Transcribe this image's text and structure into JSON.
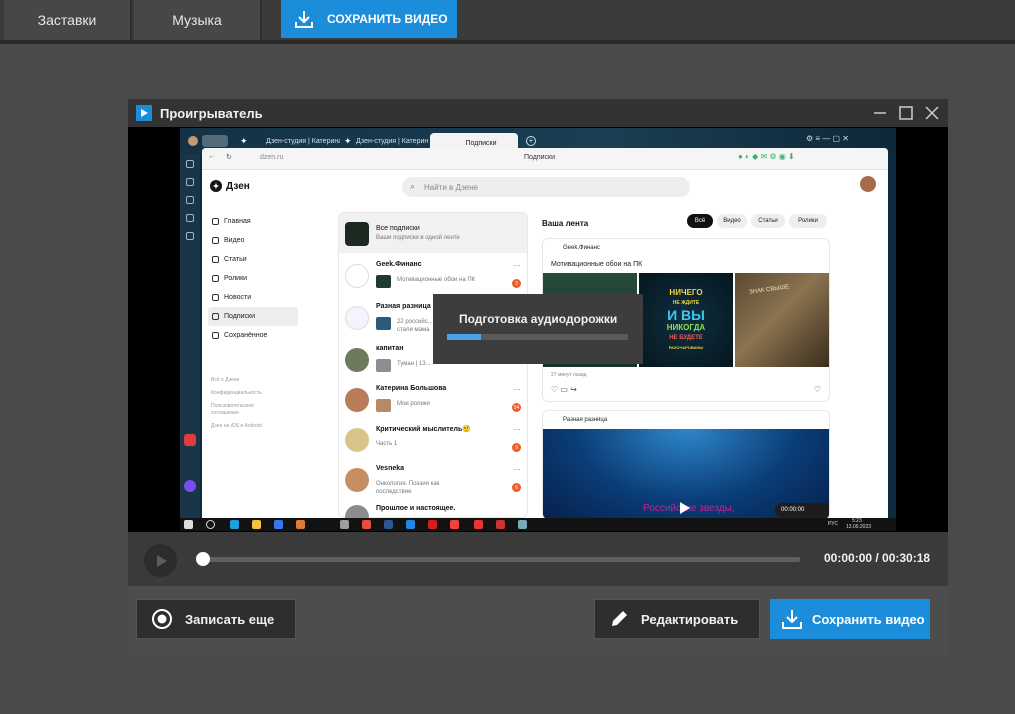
{
  "toolbar": {
    "tabs": [
      "Заставки",
      "Музыка"
    ],
    "save_label": "СОХРАНИТЬ ВИДЕО"
  },
  "player": {
    "title": "Проигрыватель",
    "preparing_label": "Подготовка аудиодорожки",
    "preparing_progress": 0.19,
    "seek_position": 0.0,
    "time": "00:00:00 / 00:30:18",
    "record_again_label": "Записать еще",
    "edit_label": "Редактировать",
    "save_video_label": "Сохранить видео"
  },
  "browser": {
    "tabs": [
      "Дзен-студия | Катерина Б...",
      "Дзен-студия | Катерина Б...",
      "Подписки"
    ],
    "address": "dzen.ru",
    "page_title": "Подписки",
    "logo": "Дзен",
    "search_placeholder": "Найти в Дзене",
    "nav": [
      "Главная",
      "Видео",
      "Статьи",
      "Ролики",
      "Новости",
      "Подписки",
      "Сохранённое"
    ],
    "footer_links": [
      "Всё о Дзене",
      "Конфиденциальность",
      "Пользовательское",
      "соглашение",
      "Дзен на iOS и Android"
    ],
    "subscriptions": [
      {
        "name": "Все подписки",
        "desc": "Ваши подписки в одной ленте",
        "badge": ""
      },
      {
        "name": "Geek.Финанс",
        "desc": "Мотивационные обои на ПК",
        "badge": "3"
      },
      {
        "name": "Разная разница",
        "desc": "22 российс...",
        "desc2": "стали мама",
        "badge": ""
      },
      {
        "name": "капитан",
        "desc": "Туман | 13...",
        "badge": ""
      },
      {
        "name": "Катерина Большова",
        "desc": "Мои ролики",
        "badge": "54"
      },
      {
        "name": "Критический мыслитель🤨",
        "desc": "Часть 1",
        "badge": "9"
      },
      {
        "name": "Vesneka",
        "desc": "Онкология. Поэзия как",
        "desc2": "последствие",
        "badge": "6"
      },
      {
        "name": "Прошлое и настоящее.",
        "desc": "",
        "badge": ""
      }
    ],
    "feed_title": "Ваша лента",
    "chips": [
      "Всё",
      "Видео",
      "Статьи",
      "Ролики"
    ],
    "card1": {
      "author": "Geek.Финанс",
      "subtitle": "Мотивационные обои на ПК",
      "img2_lines": [
        "НИЧЕГО",
        "НЕ ЖДИТЕ",
        "И ВЫ",
        "НИКОГДА",
        "НЕ БУДЕТЕ",
        "РАЗОЧАРОВАНЫ"
      ],
      "img3_text": "ЗНАК СВЫШЕ",
      "ago": "27 минут назад"
    },
    "card2": {
      "author": "Разная разница",
      "overlay": "Российские звезды,",
      "video_time": "00:00:00"
    },
    "taskbar": {
      "lang": "РУС",
      "clock": "5:23",
      "date": "13.09.2023"
    }
  }
}
